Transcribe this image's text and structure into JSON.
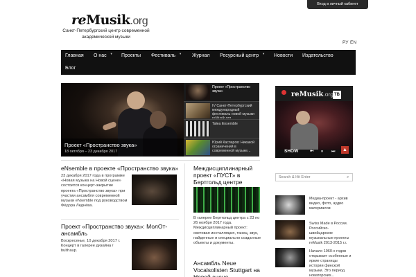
{
  "header": {
    "login_label": "Вход в личный кабинет",
    "logo_re": "re",
    "logo_main": "Musik",
    "logo_org": ".org",
    "tagline": "Санкт-Петербургский центр современной академической музыки",
    "lang_ru": "РУ",
    "lang_en": "EN"
  },
  "nav": {
    "items": [
      {
        "label": "Главная"
      },
      {
        "label": "О нас",
        "has_dropdown": true
      },
      {
        "label": "Проекты"
      },
      {
        "label": "Фестиваль",
        "has_dropdown": true
      },
      {
        "label": "Журнал"
      },
      {
        "label": "Ресурсный центр",
        "has_dropdown": true
      },
      {
        "label": "Новости"
      },
      {
        "label": "Издательство"
      },
      {
        "label": "Блог"
      }
    ]
  },
  "featured": {
    "title": "Проект «Пространство звука»",
    "date": "18 октября – 23 декабря 2017",
    "thumbs": [
      {
        "text": "Проект «Пространство звука»",
        "active": true
      },
      {
        "text": "IV Санкт-Петербургский международный фестиваль новой музыки reMusik.org"
      },
      {
        "text": "Talea Ensemble"
      },
      {
        "text": "Юрий Каспаров: Никакой ограничений в современной музыке..."
      }
    ]
  },
  "tv": {
    "logo_re": "re",
    "logo_main": "Musik",
    "logo_org": ".org",
    "badge": "ТВ",
    "show_label": "SHOW"
  },
  "articles_left": [
    {
      "title": "eNsemble в проекте «Пространство звука»",
      "text": "23 декабря 2017 года в программе «Новая музыка на Новой сцене» состоится концерт-закрытие проекта «Пространство звука» при участии ансамбля современной музыки eNsemble под руководством Фёдора Леднёва."
    },
    {
      "title": "Проект «Пространство звука»: МолОт-ансамбль",
      "text": "Воскресенье, 10 декабря 2017 г. Концерт в галерее дизайна / bulthaup."
    }
  ],
  "articles_mid": [
    {
      "title": "Междисциплинарный проект «ПУСТ» в Бертгольд центре",
      "text": "В галерее Бертгольд центра с 23 по 26 ноября 2017 года. Междисциплинарный проект: световая инсталляция, танец, звук, найденные и специально созданные объекты и документы."
    },
    {
      "title": "Ансамбль Neue Vocalsolisten Stuttgart на Новой сцене"
    }
  ],
  "sidebar": {
    "search_placeholder": "Search & Hit Enter",
    "items": [
      {
        "text": "Медиа-проект - архив видео, фото, аудио материалов"
      },
      {
        "text": "Swiss Made в России. Российско-швейцарские музыкальные проекты reMusik 2013-2015 г.г."
      },
      {
        "text": "Начало 1960-х годов открывает особенные и яркие страницы истории финской музыки. Это период новаторских..."
      }
    ]
  },
  "colors": {
    "nav_bg": "#111111",
    "accent_red": "#c0392b"
  }
}
